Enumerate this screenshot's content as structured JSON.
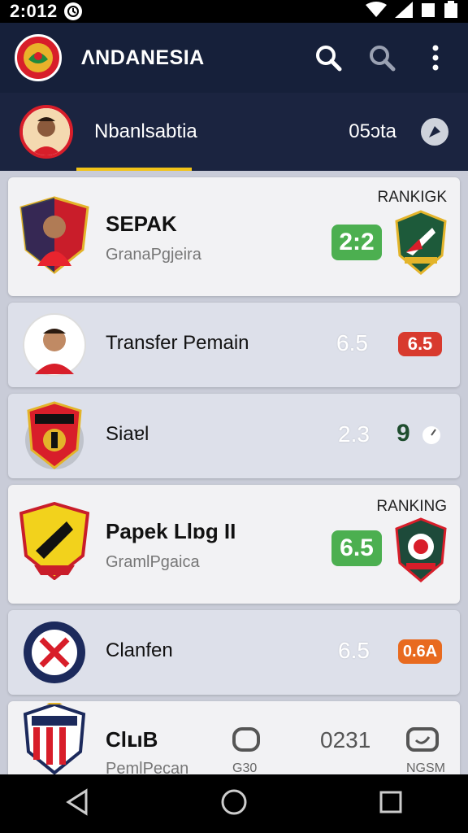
{
  "status": {
    "time": "2:012"
  },
  "app": {
    "title": "ΛNDANESIA"
  },
  "subheader": {
    "name": "Nbanlsabtia",
    "score": "05ɔta"
  },
  "items": [
    {
      "title": "SEPAK",
      "subtitle": "GranaPgjeira",
      "score": "2:2",
      "rank_label": "RANKIGK",
      "score_color": "#4caf50"
    },
    {
      "title": "Transfer Pemain",
      "score": "6.5",
      "badge": "6.5",
      "badge_color": "#d83a2e"
    },
    {
      "title": "Siaɐl",
      "score": "2.3",
      "mark": "9"
    },
    {
      "title": "Papek Llɒg  II",
      "subtitle": "GramlPgaica",
      "score": "6.5",
      "rank_label": "RANKING",
      "score_color": "#4caf50"
    },
    {
      "title": "Clanfen",
      "score": "6.5",
      "badge": "0.6A",
      "badge_color": "#e86a1f"
    },
    {
      "title": "ClւıB",
      "subtitle": "PemlPecan",
      "col1": "G30",
      "col2": "0231",
      "col3": "NGSM"
    }
  ],
  "colors": {
    "appbar": "#16203a",
    "accent": "#f2c318",
    "brand_red": "#d81e2a"
  }
}
